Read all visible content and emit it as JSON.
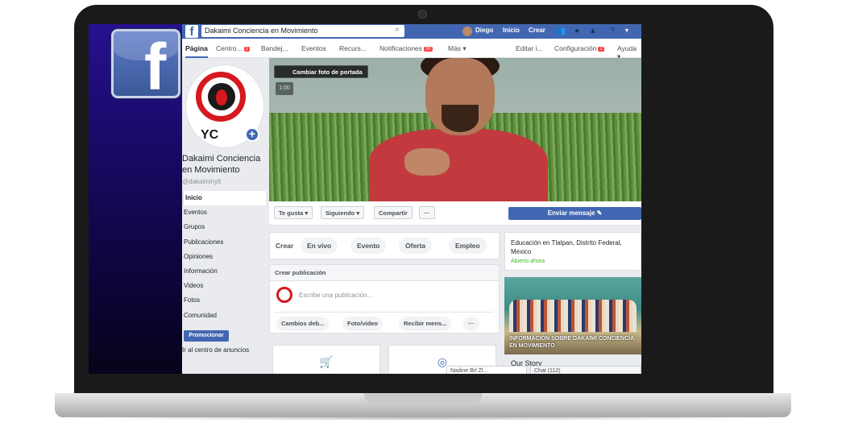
{
  "topbar": {
    "logo": "f",
    "search_value": "Dakaimi Conciencia en Movimiento",
    "user_name": "Diego",
    "home_label": "Inicio",
    "create_label": "Crear"
  },
  "tabs": {
    "pagina": "Página",
    "centro": "Centro...",
    "centro_badge": "1",
    "bandeja": "Bandej...",
    "eventos": "Eventos",
    "recursos": "Recurs...",
    "notificaciones": "Notificaciones",
    "notificaciones_badge": "30",
    "mas": "Más ▾",
    "editar": "Editar i...",
    "configuracion": "Configuración",
    "configuracion_badge": "2",
    "ayuda": "Ayuda ▾"
  },
  "profile": {
    "name": "Dakaimi Conciencia en Movimiento",
    "handle": "@dakaimihylt",
    "logo_text": "YC"
  },
  "nav": [
    "Inicio",
    "Eventos",
    "Grupos",
    "Publicaciones",
    "Opiniones",
    "Información",
    "Videos",
    "Fotos",
    "Comunidad"
  ],
  "promote_label": "Promocionar",
  "ads_link": "Ir al centro de anuncios",
  "cover": {
    "change_label": "Cambiar foto de portada",
    "time": "1:00"
  },
  "actions": {
    "like": "Te gusta ▾",
    "following": "Siguiendo ▾",
    "share": "Compartir",
    "more": "···",
    "send": "Enviar mensaje ✎"
  },
  "create": {
    "label": "Crear",
    "live": "En vivo",
    "event": "Evento",
    "offer": "Oferta",
    "job": "Empleo"
  },
  "post": {
    "header": "Crear publicación",
    "placeholder": "Escribe una publicación...",
    "change": "Cambios deb...",
    "photo": "Foto/video",
    "messages": "Recibir mens...",
    "more": "···"
  },
  "right": {
    "location": "Educación en Tlalpan, Distrito Federal, Mexico",
    "open": "Abierto ahora",
    "info_title": "INFORMACIÓN SOBRE DAKAIMI CONCIENCIA EN MOVIMIENTO",
    "our_story": "Our Story"
  },
  "chat": {
    "name": "Nadine Brl Zl...",
    "chat_label": "Chat (112)"
  }
}
